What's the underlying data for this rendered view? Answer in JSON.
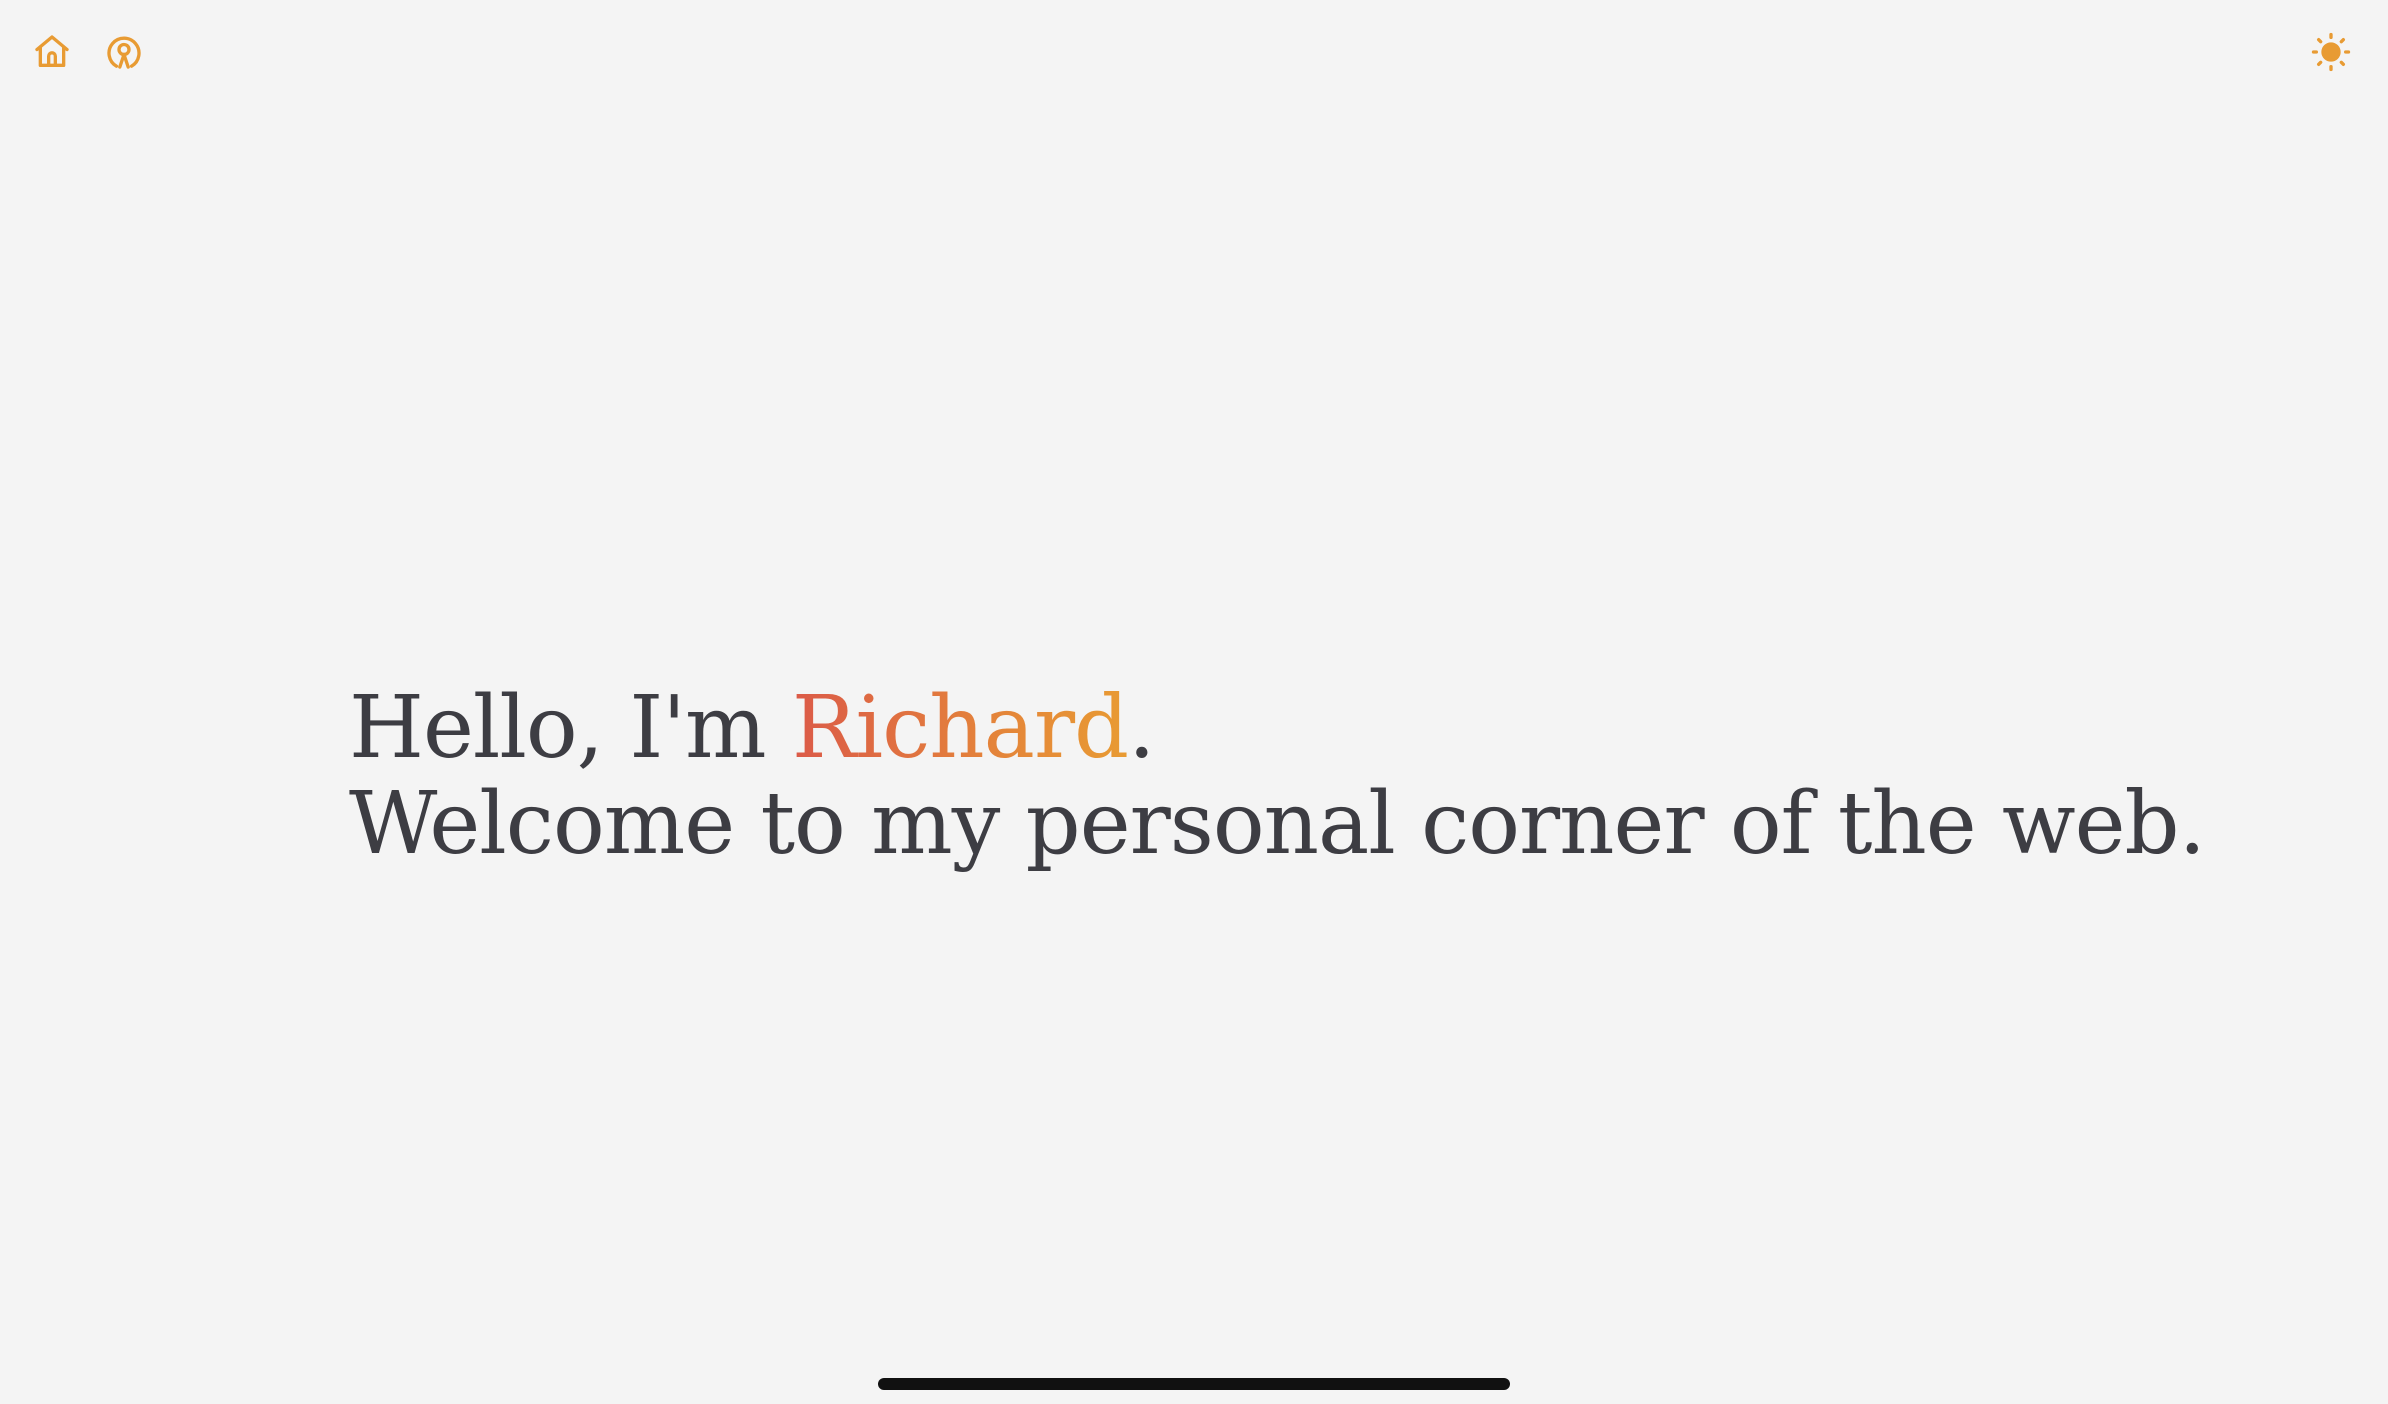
{
  "nav": {
    "home_icon": "home-icon",
    "podcast_icon": "podcast-icon",
    "theme_icon": "sun-icon"
  },
  "hero": {
    "greeting_prefix": "Hello, I'm ",
    "name": "Richard",
    "greeting_suffix": ".",
    "welcome": "Welcome to my personal corner of the web."
  },
  "colors": {
    "background": "#f4f4f4",
    "text": "#3d3d43",
    "accent": "#e89b33",
    "name_gradient_start": "#db5a48",
    "name_gradient_end": "#e89b33",
    "home_indicator": "#111111"
  }
}
